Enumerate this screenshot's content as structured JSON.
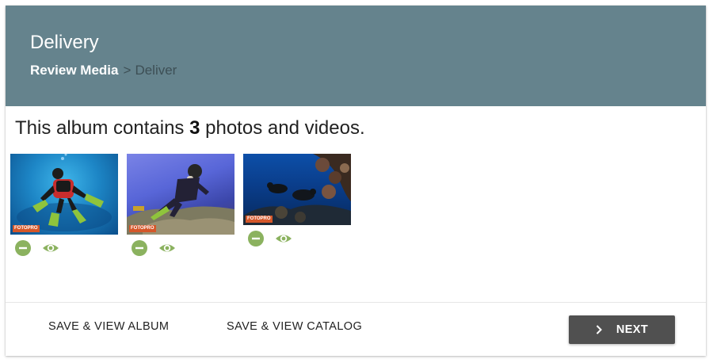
{
  "header": {
    "title": "Delivery",
    "breadcrumb": {
      "active": "Review Media",
      "separator": ">",
      "rest": "Deliver"
    },
    "background_color": "#65838d"
  },
  "summary": {
    "prefix": "This album contains",
    "count": "3",
    "suffix": "photos and videos."
  },
  "media": [
    {
      "icon": "underwater-diver-photo",
      "watermark": "FOTOPRO",
      "actions": [
        "remove-icon",
        "view-eye-icon"
      ]
    },
    {
      "icon": "underwater-diver-photo",
      "watermark": "FOTOPRO",
      "actions": [
        "remove-icon",
        "view-eye-icon"
      ]
    },
    {
      "icon": "underwater-coral-divers-photo",
      "watermark": "FOTOPRO",
      "actions": [
        "remove-icon",
        "view-eye-icon"
      ]
    }
  ],
  "action_icon_color": "#8bb25f",
  "footer": {
    "save_album_label": "SAVE & VIEW ALBUM",
    "save_catalog_label": "SAVE & VIEW CATALOG",
    "next_label": "NEXT",
    "next_button_color": "#505050"
  }
}
